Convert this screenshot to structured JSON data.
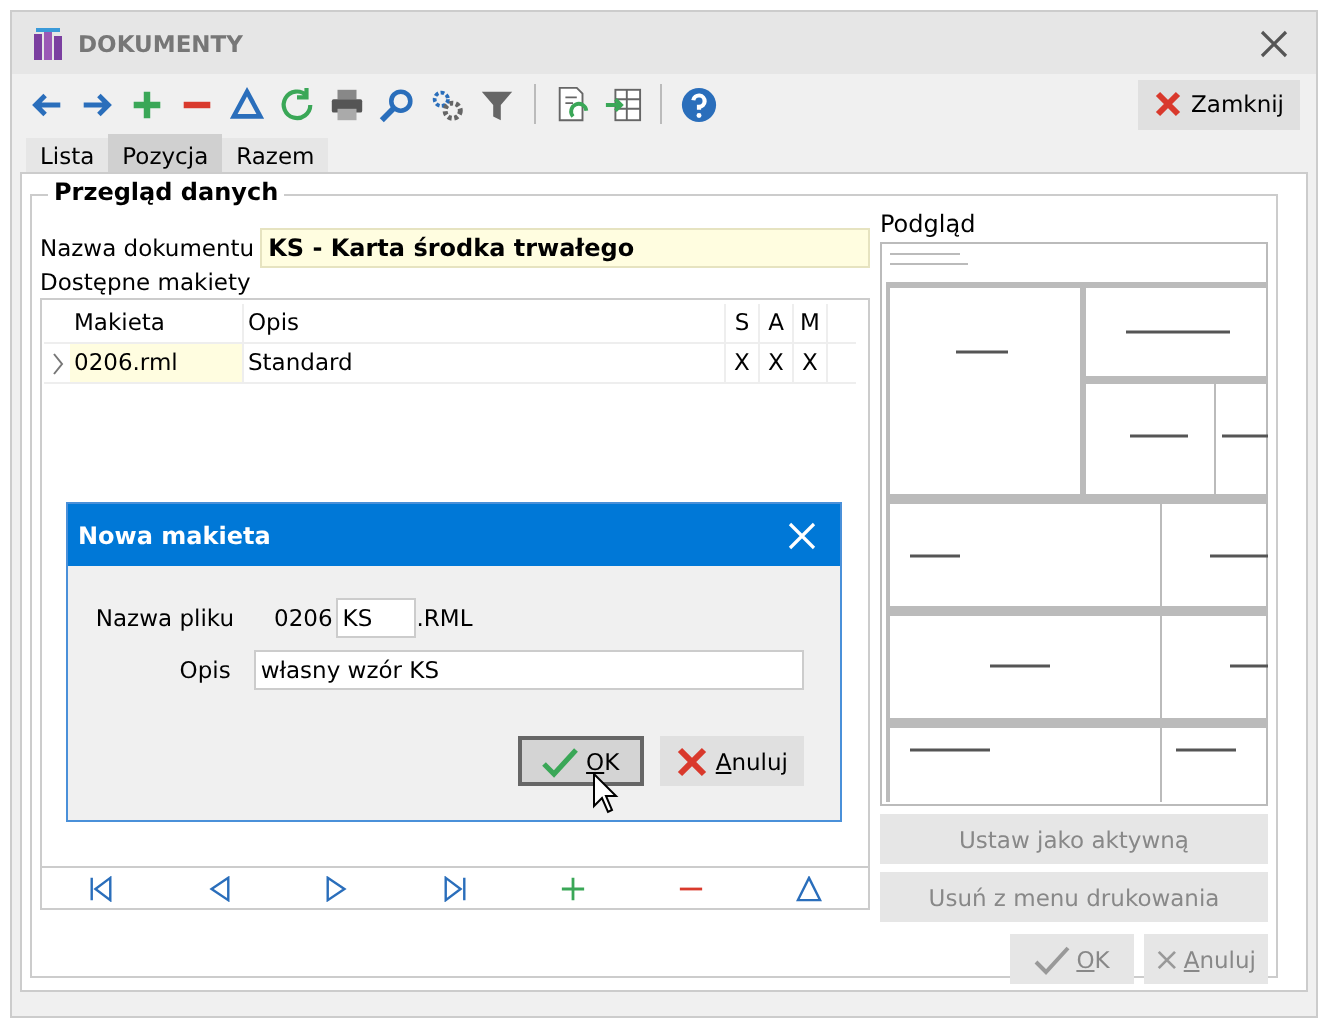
{
  "window": {
    "title": "DOKUMENTY"
  },
  "toolbar": {
    "close_button": "Zamknij"
  },
  "tabs": [
    {
      "label": "Lista",
      "selected": false
    },
    {
      "label": "Pozycja",
      "selected": true
    },
    {
      "label": "Razem",
      "selected": false
    }
  ],
  "group": {
    "title": "Przegląd danych",
    "document_name_label": "Nazwa dokumentu",
    "document_name": "KS - Karta środka trwałego",
    "layouts_label": "Dostępne makiety",
    "table": {
      "columns": [
        "Makieta",
        "Opis",
        "S",
        "A",
        "M"
      ],
      "rows": [
        {
          "selected": true,
          "cells": [
            "0206.rml",
            "Standard",
            "X",
            "X",
            "X"
          ]
        }
      ]
    },
    "preview_label": "Podgląd",
    "side_buttons": [
      {
        "label": "Ustaw jako aktywną",
        "disabled": true
      },
      {
        "label": "Usuń z menu drukowania",
        "disabled": true
      }
    ],
    "ok_button": {
      "label": "OK",
      "disabled": true
    },
    "cancel_button": {
      "label": "Anuluj",
      "disabled": true
    }
  },
  "dialog": {
    "title": "Nowa makieta",
    "file_name_label": "Nazwa pliku",
    "file_prefix": "0206",
    "file_name": "KS",
    "file_extension": ".RML",
    "description_label": "Opis",
    "description": "własny wzór KS",
    "ok_button": "OK",
    "cancel_button": "Anuluj"
  }
}
